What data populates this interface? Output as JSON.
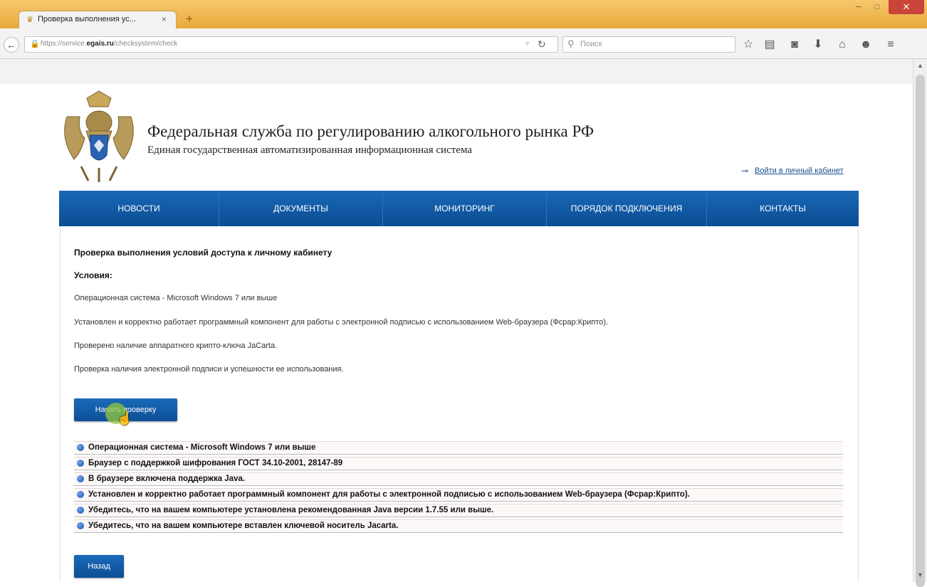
{
  "browser": {
    "tab_title": "Проверка выполнения ус...",
    "tab_close": "×",
    "new_tab": "+",
    "url_prefix": "https://service.",
    "url_domain": "egais.ru",
    "url_path": "/checksystem/check",
    "search_placeholder": "Поиск",
    "window_controls": {
      "minimize": "–",
      "maximize": "□",
      "close": "✕"
    }
  },
  "header": {
    "title": "Федеральная служба по регулированию алкогольного рынка РФ",
    "subtitle": "Единая государственная автоматизированная информационная система",
    "login_link": "Войти в личный кабинет"
  },
  "menu": {
    "items": [
      {
        "label": "НОВОСТИ"
      },
      {
        "label": "ДОКУМЕНТЫ"
      },
      {
        "label": "МОНИТОРИНГ"
      },
      {
        "label": "ПОРЯДОК ПОДКЛЮЧЕНИЯ"
      },
      {
        "label": "КОНТАКТЫ"
      }
    ]
  },
  "content": {
    "heading": "Проверка выполнения условий доступа к личному кабинету",
    "conditions_label": "Условия:",
    "conditions": [
      "Операционная система - Microsoft Windows 7 или выше",
      "Установлен и корректно работает программный компонент для работы с электронной подписью с использованием Web-браузера (Фсрар:Крипто).",
      "Проверено наличие аппаратного крипто-ключа JaCarta.",
      "Проверка наличия электронной подписи и успешности ее использования."
    ],
    "start_button": "Начать проверку",
    "results": [
      "Операционная система - Microsoft Windows 7 или выше",
      "Браузер с поддержкой шифрования ГОСТ 34.10-2001, 28147-89",
      "В браузере включена поддержка Java.",
      "Установлен и корректно работает программный компонент для работы с электронной подписью с использованием Web-браузера (Фсрар:Крипто).",
      "Убедитесь, что на вашем компьютере установлена рекомендованная Java версии 1.7.55 или выше.",
      "Убедитесь, что на вашем компьютере вставлен ключевой носитель Jacarta."
    ],
    "back_button": "Назад"
  },
  "colors": {
    "menu_blue": "#0b4d93",
    "button_blue": "#1a6ab9",
    "titlebar": "#e9a93c",
    "result_dot": "#1a4ea8"
  }
}
